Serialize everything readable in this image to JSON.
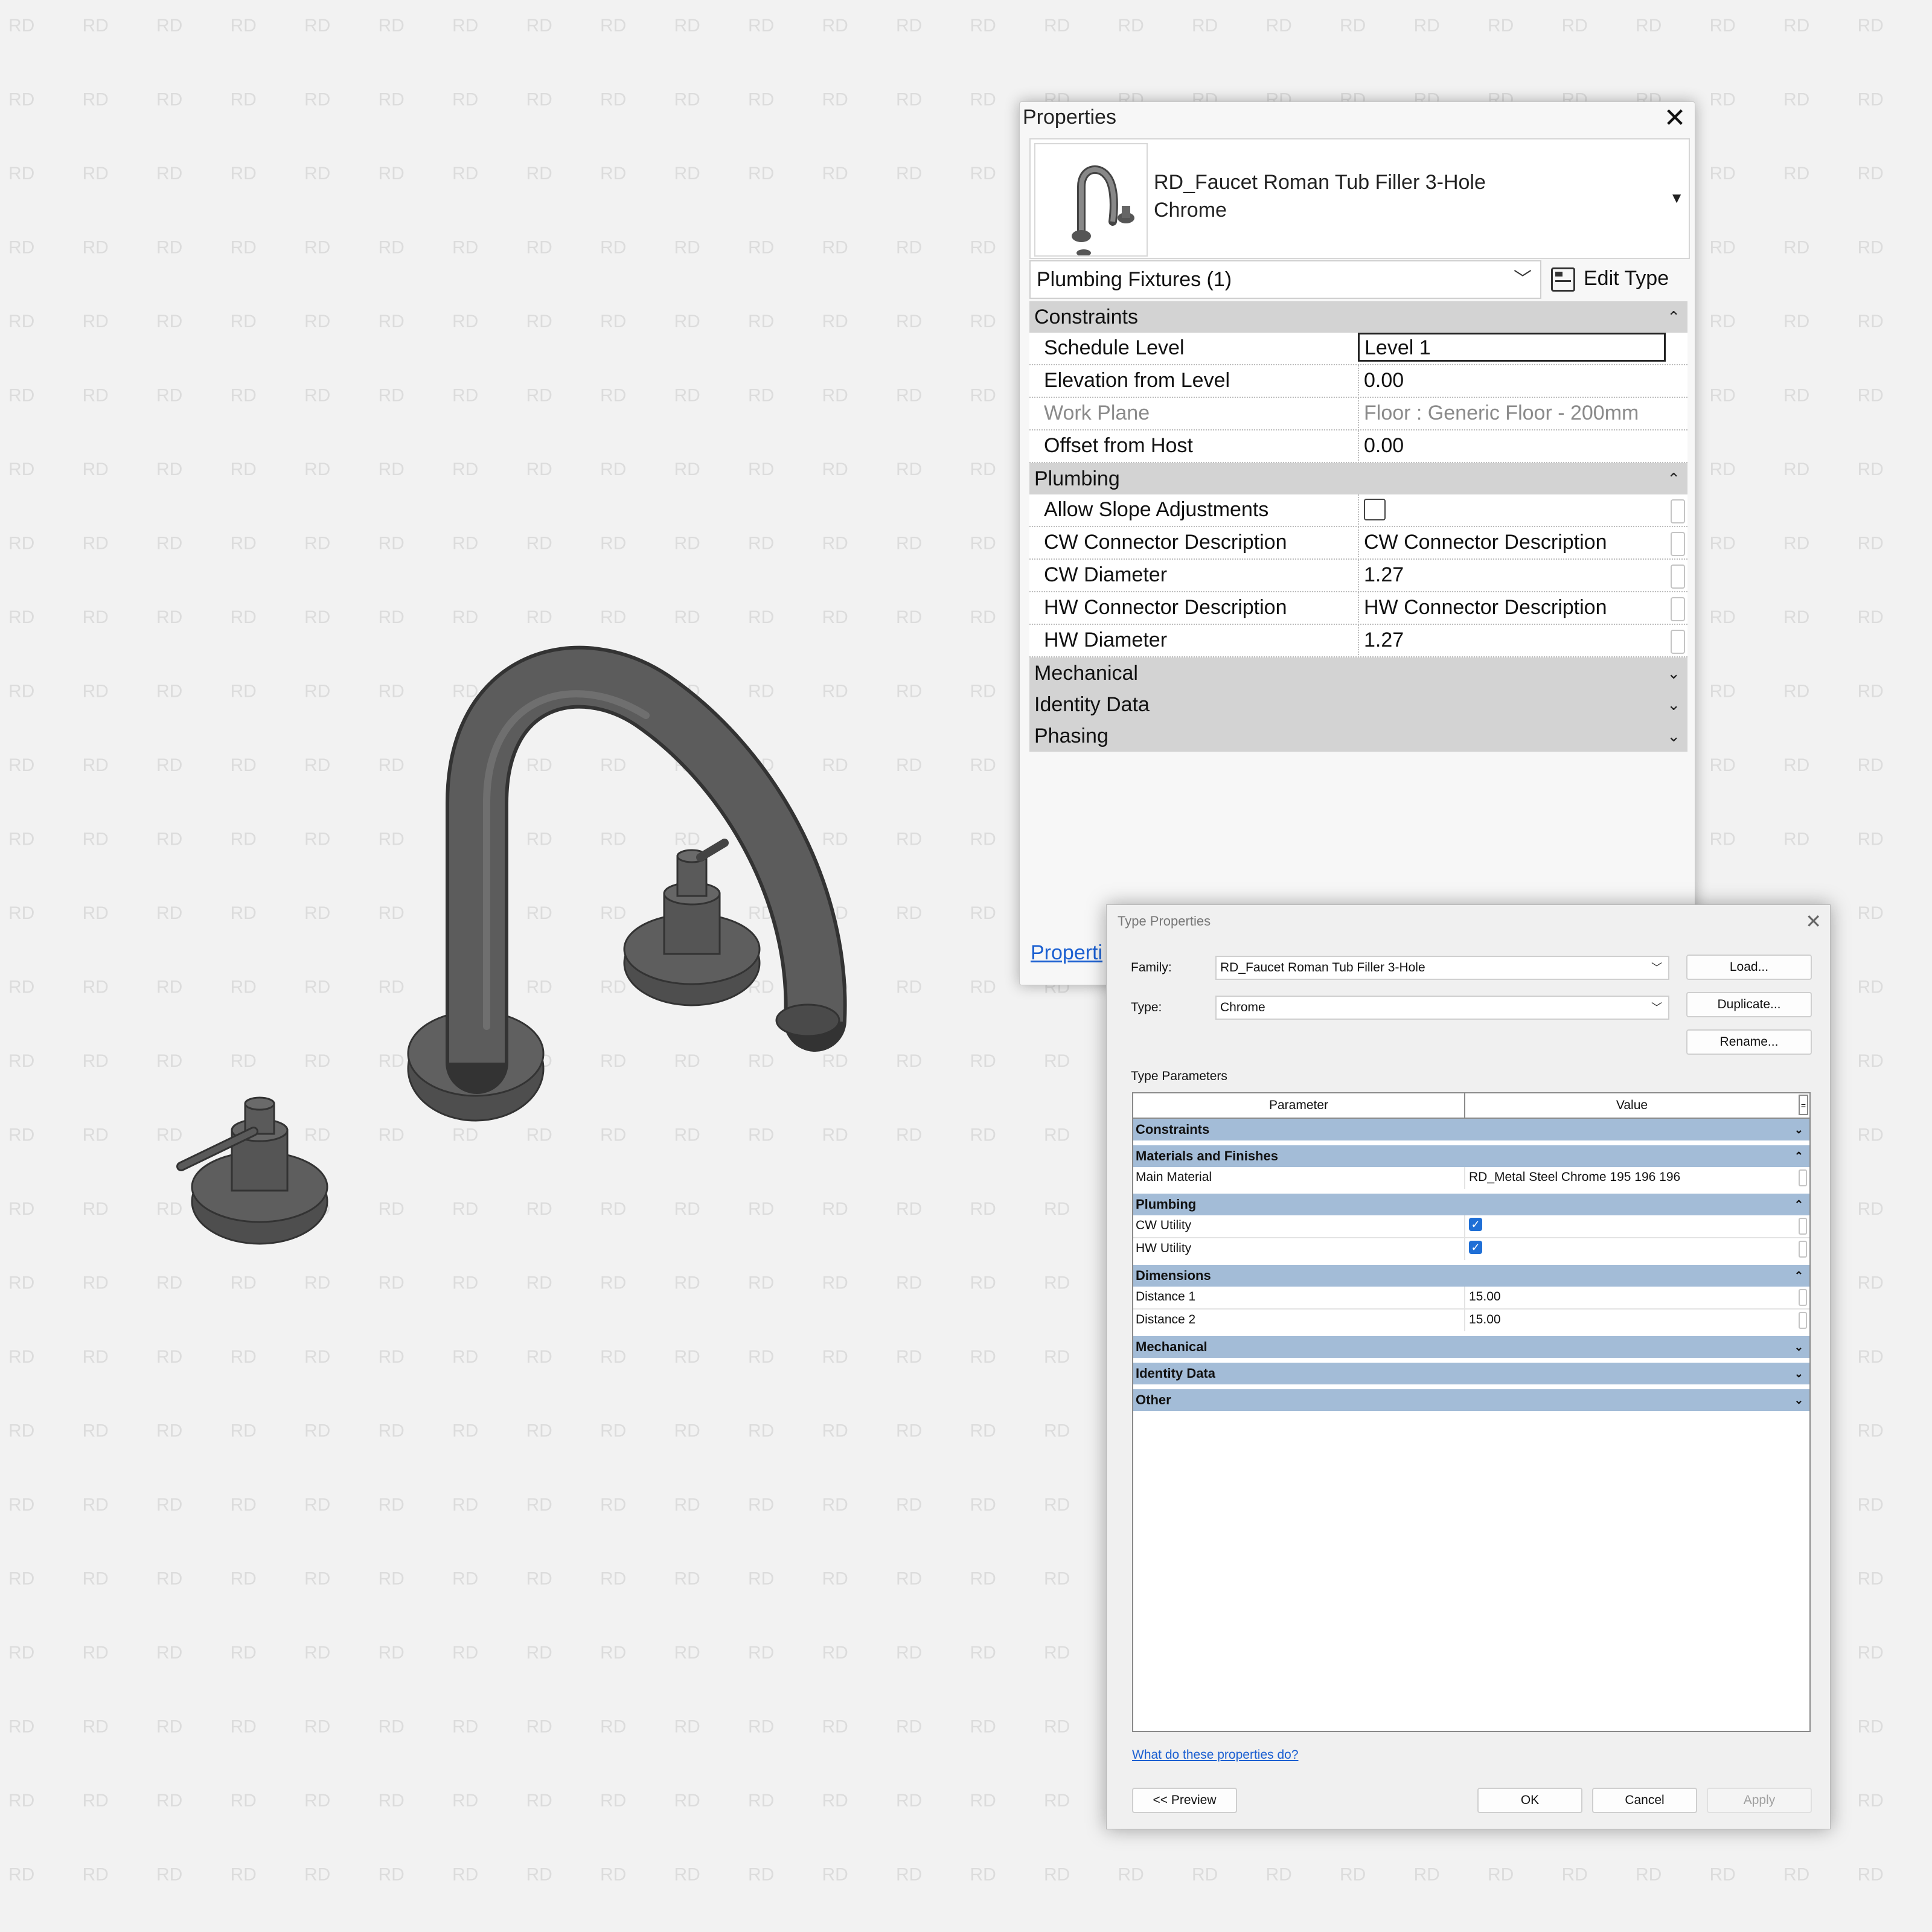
{
  "watermark": {
    "text": "RD",
    "color": "#dcdcdc"
  },
  "model": {
    "name": "faucet-3d-view",
    "color": "#555555"
  },
  "properties": {
    "title": "Properties",
    "type_name_line1": "RD_Faucet Roman Tub Filler 3-Hole",
    "type_name_line2": "Chrome",
    "category": "Plumbing Fixtures (1)",
    "edit_type": "Edit Type",
    "groups": {
      "constraints": "Constraints",
      "plumbing": "Plumbing",
      "mechanical": "Mechanical",
      "identity": "Identity Data",
      "phasing": "Phasing"
    },
    "constraints_rows": [
      {
        "name": "Schedule Level",
        "value": "Level 1"
      },
      {
        "name": "Elevation from Level",
        "value": "0.00"
      },
      {
        "name": "Work Plane",
        "value": "Floor : Generic Floor - 200mm"
      },
      {
        "name": "Offset from Host",
        "value": "0.00"
      }
    ],
    "plumbing_rows": [
      {
        "name": "Allow Slope Adjustments",
        "value": ""
      },
      {
        "name": "CW Connector Description",
        "value": "CW Connector Description"
      },
      {
        "name": "CW Diameter",
        "value": "1.27"
      },
      {
        "name": "HW Connector Description",
        "value": "HW Connector Description"
      },
      {
        "name": "HW Diameter",
        "value": "1.27"
      }
    ],
    "help_link": "Properti"
  },
  "type_properties": {
    "title": "Type Properties",
    "family_label": "Family:",
    "family_value": "RD_Faucet Roman Tub Filler 3-Hole",
    "type_label": "Type:",
    "type_value": "Chrome",
    "load": "Load...",
    "duplicate": "Duplicate...",
    "rename": "Rename...",
    "type_parameters": "Type Parameters",
    "col_parameter": "Parameter",
    "col_value": "Value",
    "col_extra": "=",
    "groups": {
      "constraints": "Constraints",
      "materials": "Materials and Finishes",
      "plumbing": "Plumbing",
      "dimensions": "Dimensions",
      "mechanical": "Mechanical",
      "identity": "Identity Data",
      "other": "Other"
    },
    "main_material": {
      "name": "Main Material",
      "value": "RD_Metal Steel Chrome 195 196 196"
    },
    "cw_utility": {
      "name": "CW Utility",
      "checked": true
    },
    "hw_utility": {
      "name": "HW Utility",
      "checked": true
    },
    "distance1": {
      "name": "Distance 1",
      "value": "15.00"
    },
    "distance2": {
      "name": "Distance 2",
      "value": "15.00"
    },
    "help_link": "What do these properties do?",
    "preview": "<< Preview",
    "ok": "OK",
    "cancel": "Cancel",
    "apply": "Apply",
    "accent": "#a3bcd7"
  }
}
